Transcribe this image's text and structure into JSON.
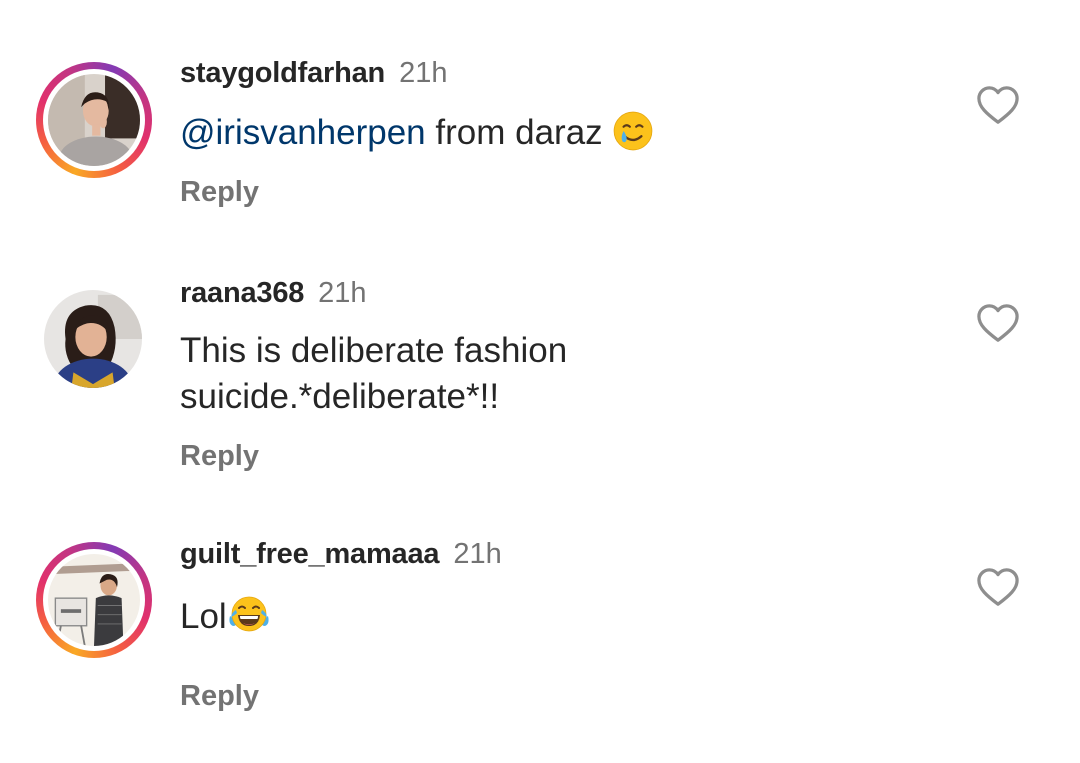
{
  "comments": [
    {
      "username": "staygoldfarhan",
      "time": "21h",
      "mention": "@irisvanherpen",
      "text": " from daraz ",
      "emoji_icon": "smiling-face-with-tear-icon",
      "reply_label": "Reply",
      "has_story_ring": true
    },
    {
      "username": "raana368",
      "time": "21h",
      "text_line1": "This is deliberate fashion",
      "text_line2": "suicide.*deliberate*!!",
      "reply_label": "Reply",
      "has_story_ring": false
    },
    {
      "username": "guilt_free_mamaaa",
      "time": "21h",
      "text": "Lol",
      "emoji_icon": "face-with-tears-of-joy-icon",
      "reply_label": "Reply",
      "has_story_ring": true
    }
  ],
  "colors": {
    "text": "#262626",
    "secondary": "#737373",
    "mention": "#00376b",
    "ring_start": "#f9a825",
    "ring_end": "#c13584"
  }
}
